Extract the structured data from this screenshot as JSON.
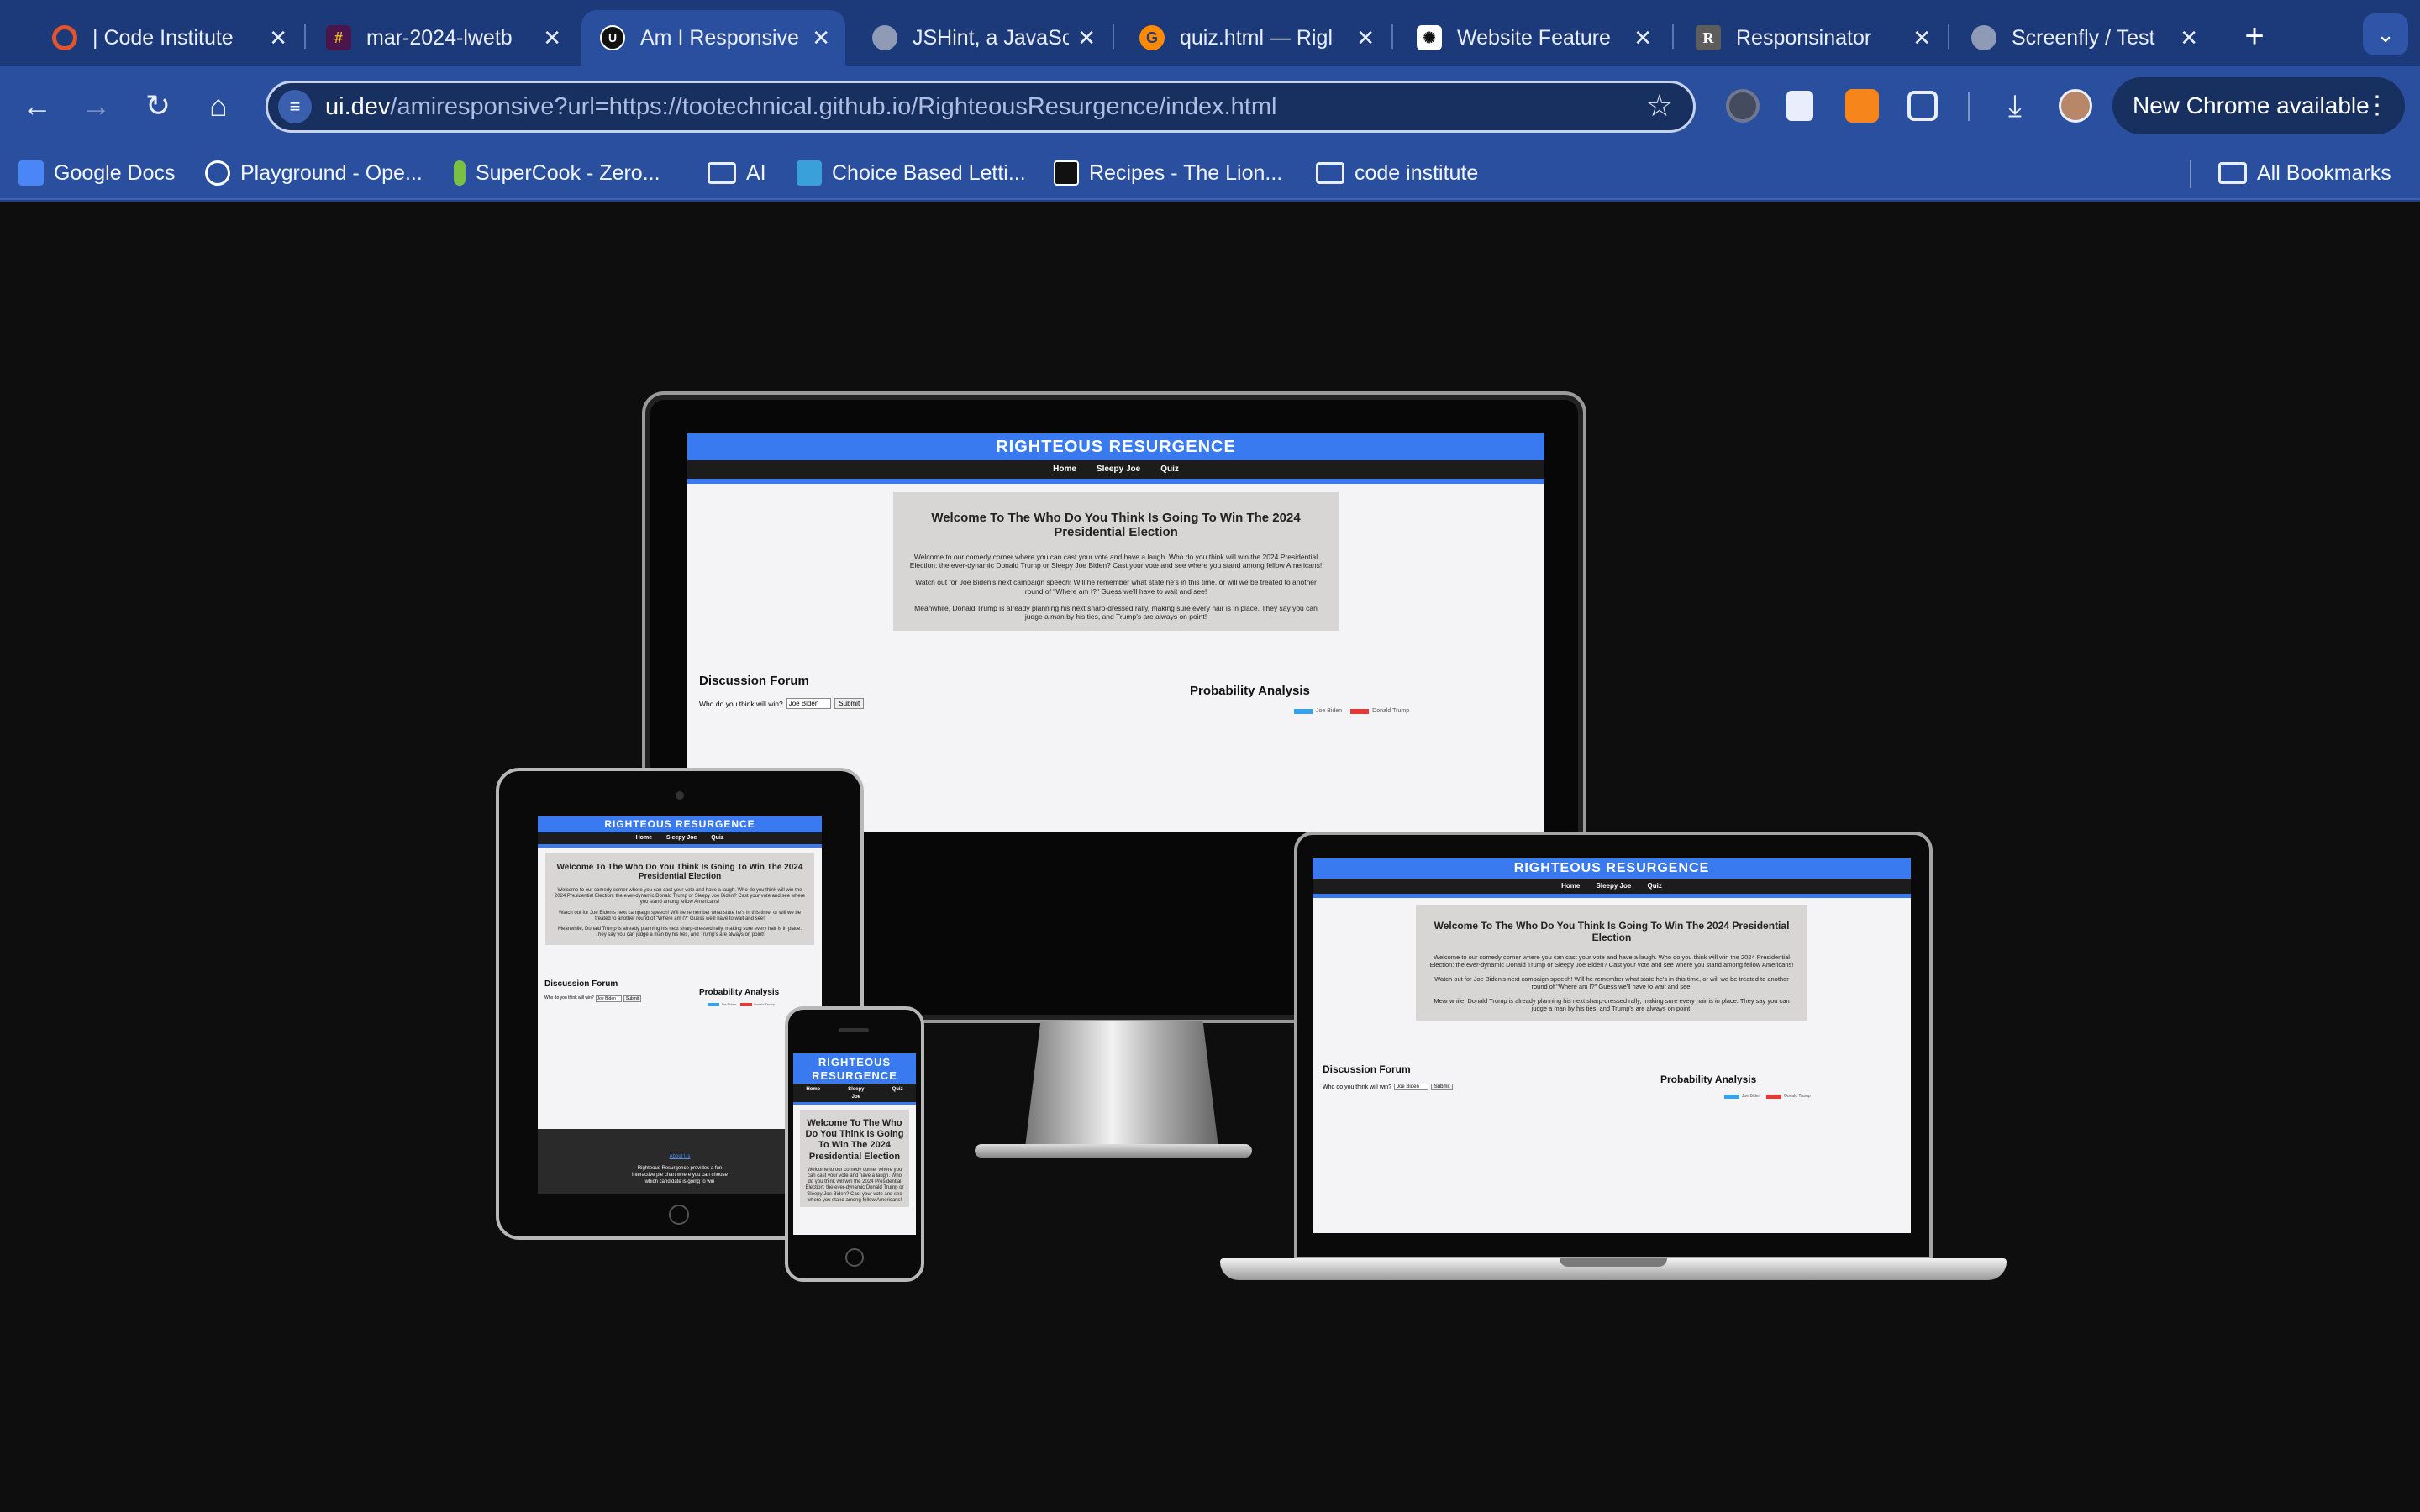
{
  "browser": {
    "tabs": [
      {
        "title": "| Code Institute",
        "icon": "code-institute-icon",
        "color": "#e0542e",
        "active": false
      },
      {
        "title": "mar-2024-lwetb",
        "icon": "slack-icon",
        "color": "#e01e5a",
        "active": false
      },
      {
        "title": "Am I Responsive",
        "icon": "ui-dev-icon",
        "color": "#111111",
        "active": true
      },
      {
        "title": "JSHint, a JavaSc",
        "icon": "globe-icon",
        "color": "#9aa6bf",
        "active": false
      },
      {
        "title": "quiz.html — Rigl",
        "icon": "gitpod-icon",
        "color": "#ff8a00",
        "active": false
      },
      {
        "title": "Website Feature",
        "icon": "chatgpt-icon",
        "color": "#ffffff",
        "active": false
      },
      {
        "title": "Responsinator",
        "icon": "responsinator-icon",
        "color": "#5d5d5d",
        "active": false
      },
      {
        "title": "Screenfly / Test",
        "icon": "globe-icon",
        "color": "#9aa6bf",
        "active": false
      }
    ],
    "url_domain": "ui.dev",
    "url_rest": "/amiresponsive?url=https://tootechnical.github.io/RighteousResurgence/index.html",
    "new_chrome_label": "New Chrome available",
    "bookmarks": [
      {
        "label": "Google Docs",
        "icon": "google-docs-icon",
        "color": "#4a86f7"
      },
      {
        "label": "Playground - Ope...",
        "icon": "openai-icon",
        "color": "#ffffff"
      },
      {
        "label": "SuperCook - Zero...",
        "icon": "supercook-icon",
        "color": "#7ac143"
      },
      {
        "label": "AI",
        "icon": "folder-icon",
        "color": ""
      },
      {
        "label": "Choice Based Letti...",
        "icon": "choice-based-icon",
        "color": "#3aa0d8"
      },
      {
        "label": "Recipes - The Lion...",
        "icon": "lion-icon",
        "color": "#111111"
      },
      {
        "label": "code institute",
        "icon": "folder-icon",
        "color": ""
      }
    ],
    "all_bookmarks_label": "All Bookmarks"
  },
  "site": {
    "brand": "RIGHTEOUS RESURGENCE",
    "brand_mobile_1": "RIGHTEOUS",
    "brand_mobile_2": "RESURGENCE",
    "nav": [
      "Home",
      "Sleepy Joe",
      "Quiz"
    ],
    "welcome_title": "Welcome To The Who Do You Think Is Going To Win The 2024 Presidential Election",
    "para1": "Welcome to our comedy corner where you can cast your vote and have a laugh. Who do you think will win the 2024 Presidential Election: the ever-dynamic Donald Trump or Sleepy Joe Biden? Cast your vote and see where you stand among fellow Americans!",
    "para2": "Watch out for Joe Biden's next campaign speech! Will he remember what state he's in this time, or will we be treated to another round of \"Where am I?\" Guess we'll have to wait and see!",
    "para3": "Meanwhile, Donald Trump is already planning his next sharp-dressed rally, making sure every hair is in place. They say you can judge a man by his ties, and Trump's are always on point!",
    "forum_title": "Discussion Forum",
    "forum_question": "Who do you think will win?",
    "select_value": "Joe Biden",
    "submit_label": "Submit",
    "analysis_title": "Probability Analysis",
    "legend": [
      {
        "name": "Joe Biden",
        "color": "#36a2eb"
      },
      {
        "name": "Donald Trump",
        "color": "#e53935"
      }
    ],
    "about_title": "About Us",
    "about_text": "Righteous Resurgence provides a fun interactive pie chart where you can choose which candidate is going to win"
  }
}
